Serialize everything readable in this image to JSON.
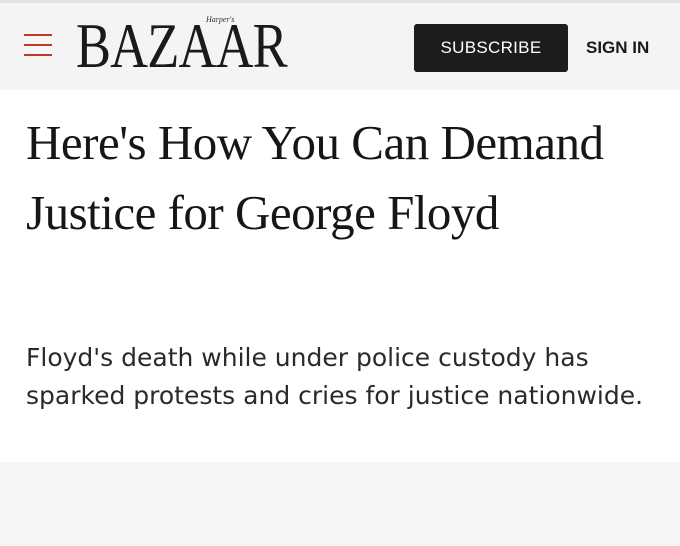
{
  "header": {
    "logo_text": "BAZAAR",
    "logo_small_text": "Harper's",
    "subscribe_label": "SUBSCRIBE",
    "signin_label": "SIGN IN",
    "menu_icon": "hamburger-menu-icon",
    "accent_color": "#c0392b"
  },
  "article": {
    "headline": "Here's How You Can Demand Justice for George Floyd",
    "dek": "Floyd's death while under police custody has sparked protests and cries for justice nationwide."
  }
}
